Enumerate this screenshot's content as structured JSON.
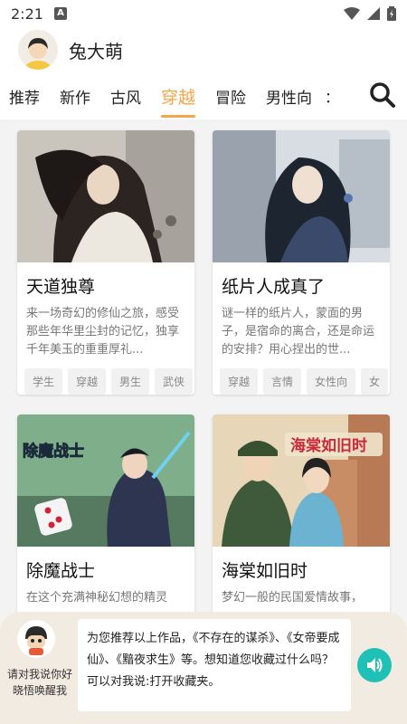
{
  "status": {
    "time": "2:21",
    "sim_label": "A"
  },
  "user": {
    "name": "兔大萌"
  },
  "tabs": [
    "推荐",
    "新作",
    "古风",
    "穿越",
    "冒险",
    "男性向"
  ],
  "active_tab": "穿越",
  "tab_more": "：",
  "books": [
    {
      "title": "天道独尊",
      "desc": "来一场奇幻的修仙之旅，感受那些年华里尘封的记忆，独享千年美玉的重重厚礼...",
      "tags": [
        "学生",
        "穿越",
        "男生",
        "武侠"
      ]
    },
    {
      "title": "纸片人成真了",
      "desc": "谜一样的纸片人，蒙面的男子，是宿命的离合，还是命运的安排？用心捏出的世...",
      "tags": [
        "穿越",
        "言情",
        "女性向",
        "女"
      ]
    },
    {
      "title": "除魔战士",
      "desc": "在这个充满神秘幻想的精灵",
      "tags": [],
      "cover_text": "除魔战士"
    },
    {
      "title": "海棠如旧时",
      "desc": "梦幻一般的民国爱情故事，",
      "tags": [],
      "cover_text": "海棠如旧时"
    }
  ],
  "assistant": {
    "hint": "请对我说你好晓悟唤醒我",
    "message": "为您推荐以上作品，《不存在的谋杀》、《女帝要成仙》、《黯夜求生》等。想知道您收藏过什么吗？可以对我说:打开收藏夹。"
  },
  "colors": {
    "accent": "#f3a64a",
    "speaker": "#1fc0b5",
    "bottom_panel": "#f2ebe1"
  }
}
